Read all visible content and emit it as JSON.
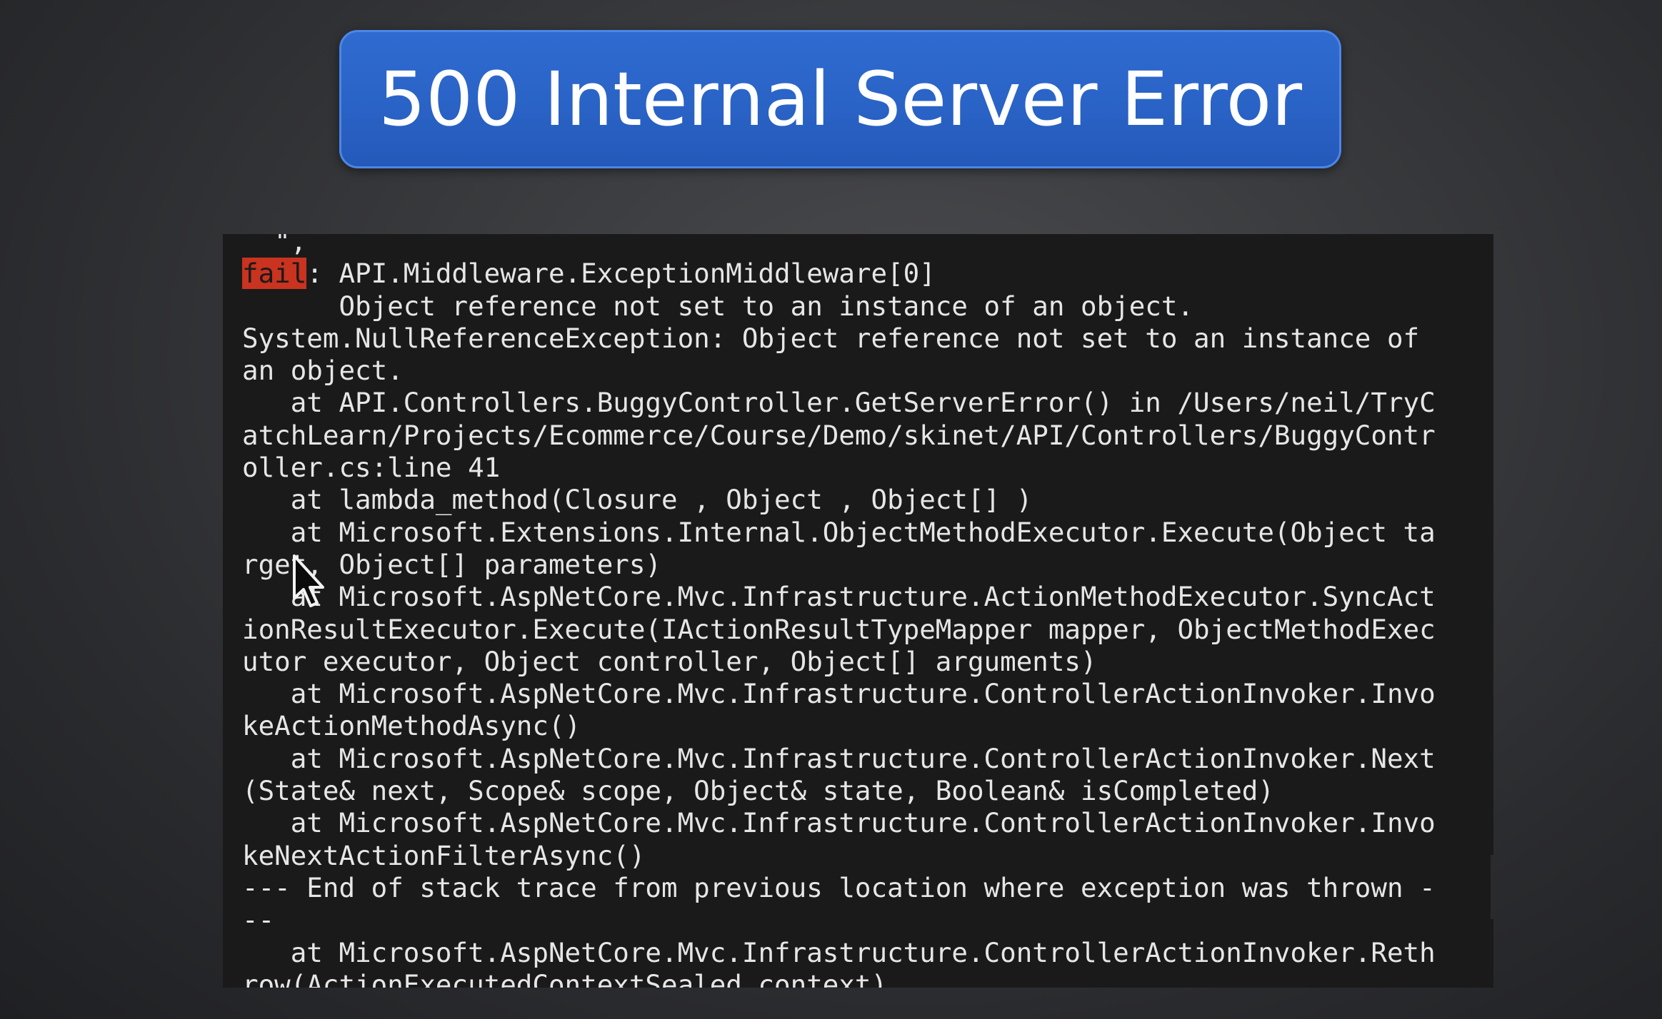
{
  "title": "500 Internal Server Error",
  "terminal": {
    "lines": [
      {
        "text": "  \",",
        "partial": true
      },
      {
        "badge": "fail",
        "text": ": API.Middleware.ExceptionMiddleware[0]"
      },
      {
        "text": "      Object reference not set to an instance of an object."
      },
      {
        "text": "System.NullReferenceException: Object reference not set to an instance of"
      },
      {
        "text": "an object."
      },
      {
        "text": "   at API.Controllers.BuggyController.GetServerError() in /Users/neil/TryC"
      },
      {
        "text": "atchLearn/Projects/Ecommerce/Course/Demo/skinet/API/Controllers/BuggyContr"
      },
      {
        "text": "oller.cs:line 41"
      },
      {
        "text": "   at lambda_method(Closure , Object , Object[] )"
      },
      {
        "text": "   at Microsoft.Extensions.Internal.ObjectMethodExecutor.Execute(Object ta"
      },
      {
        "text": "rget, Object[] parameters)"
      },
      {
        "text": "   at Microsoft.AspNetCore.Mvc.Infrastructure.ActionMethodExecutor.SyncAct"
      },
      {
        "text": "ionResultExecutor.Execute(IActionResultTypeMapper mapper, ObjectMethodExec"
      },
      {
        "text": "utor executor, Object controller, Object[] arguments)"
      },
      {
        "text": "   at Microsoft.AspNetCore.Mvc.Infrastructure.ControllerActionInvoker.Invo"
      },
      {
        "text": "keActionMethodAsync()"
      },
      {
        "text": "   at Microsoft.AspNetCore.Mvc.Infrastructure.ControllerActionInvoker.Next"
      },
      {
        "text": "(State& next, Scope& scope, Object& state, Boolean& isCompleted)"
      },
      {
        "text": "   at Microsoft.AspNetCore.Mvc.Infrastructure.ControllerActionInvoker.Invo"
      },
      {
        "text": "keNextActionFilterAsync()"
      },
      {
        "text": "--- End of stack trace from previous location where exception was thrown -"
      },
      {
        "text": "--"
      },
      {
        "text": "   at Microsoft.AspNetCore.Mvc.Infrastructure.ControllerActionInvoker.Reth"
      },
      {
        "text": "row(ActionExecutedContextSealed context)"
      }
    ]
  },
  "colors": {
    "banner": "#2a63c6",
    "terminal_bg": "#1a1a1a",
    "terminal_text": "#e6e6e6",
    "fail_badge": "#c9331f"
  },
  "icons": {
    "cursor": "mouse-pointer-icon"
  }
}
